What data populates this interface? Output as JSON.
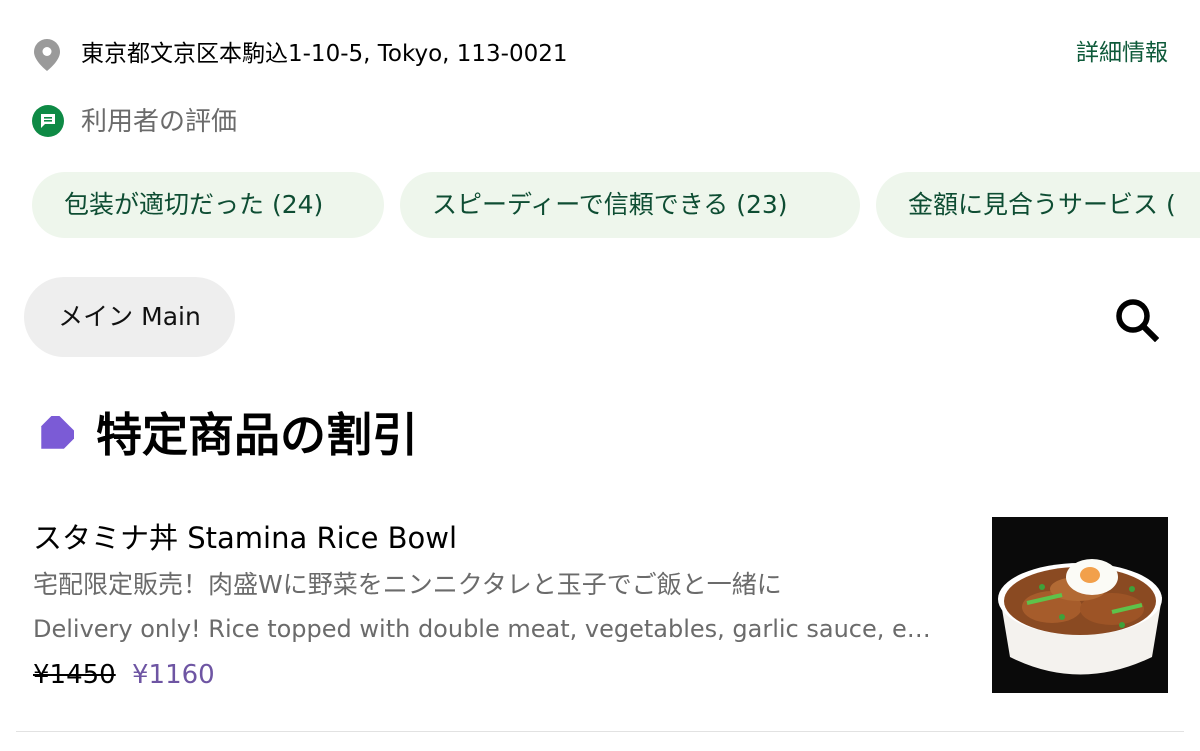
{
  "store": {
    "address": "東京都文京区本駒込1-10-5, Tokyo, 113-0021",
    "details_link": "詳細情報",
    "pin_icon": "location-pin-icon"
  },
  "ratings": {
    "title": "利用者の評価",
    "icon": "chat-bubble-icon",
    "chips": [
      {
        "label": "包装が適切だった (24)"
      },
      {
        "label": "スピーディーで信頼できる (23)"
      },
      {
        "label": "金額に見合うサービス ("
      }
    ]
  },
  "menu": {
    "category_pill": "メイン Main",
    "search_icon": "search-icon"
  },
  "promo": {
    "title": "特定商品の割引",
    "icon": "tag-icon",
    "accent_color": "#7b5bd6"
  },
  "item": {
    "title": "スタミナ丼 Stamina Rice Bowl",
    "description_ja": "宅配限定販売！肉盛Wに野菜をニンニクタレと玉子でご飯と一緒に",
    "description_en": "Delivery only! Rice topped with double meat, vegetables, garlic sauce, egg and more",
    "price_original": "¥1450",
    "price_discounted": "¥1160",
    "discount_color": "#6e55a3"
  }
}
